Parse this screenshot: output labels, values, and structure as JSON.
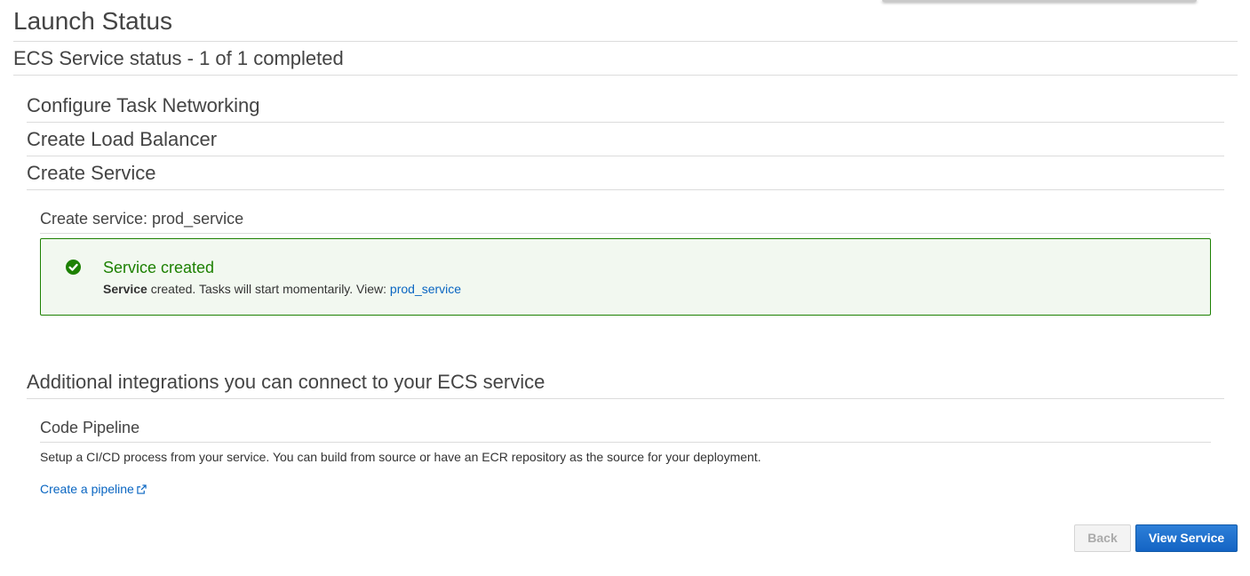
{
  "page": {
    "title": "Launch Status"
  },
  "ecs_status": {
    "heading": "ECS Service status - 1 of 1 completed"
  },
  "steps": [
    {
      "label": "Configure Task Networking"
    },
    {
      "label": "Create Load Balancer"
    },
    {
      "label": "Create Service"
    }
  ],
  "create_service": {
    "heading": "Create service: prod_service",
    "alert": {
      "icon": "check-circle-icon",
      "title": "Service created",
      "body_bold": "Service",
      "body_text": " created. Tasks will start momentarily. View: ",
      "link_text": "prod_service",
      "color": "#1d8102"
    }
  },
  "integrations": {
    "heading": "Additional integrations you can connect to your ECS service",
    "code_pipeline": {
      "heading": "Code Pipeline",
      "description": "Setup a CI/CD process from your service. You can build from source or have an ECR repository as the source for your deployment.",
      "link_text": "Create a pipeline",
      "link_icon": "external-link-icon"
    }
  },
  "footer": {
    "back_label": "Back",
    "view_service_label": "View Service",
    "primary_color": "#1464c4"
  },
  "colors": {
    "link": "#0a66c2",
    "success": "#1d8102"
  }
}
